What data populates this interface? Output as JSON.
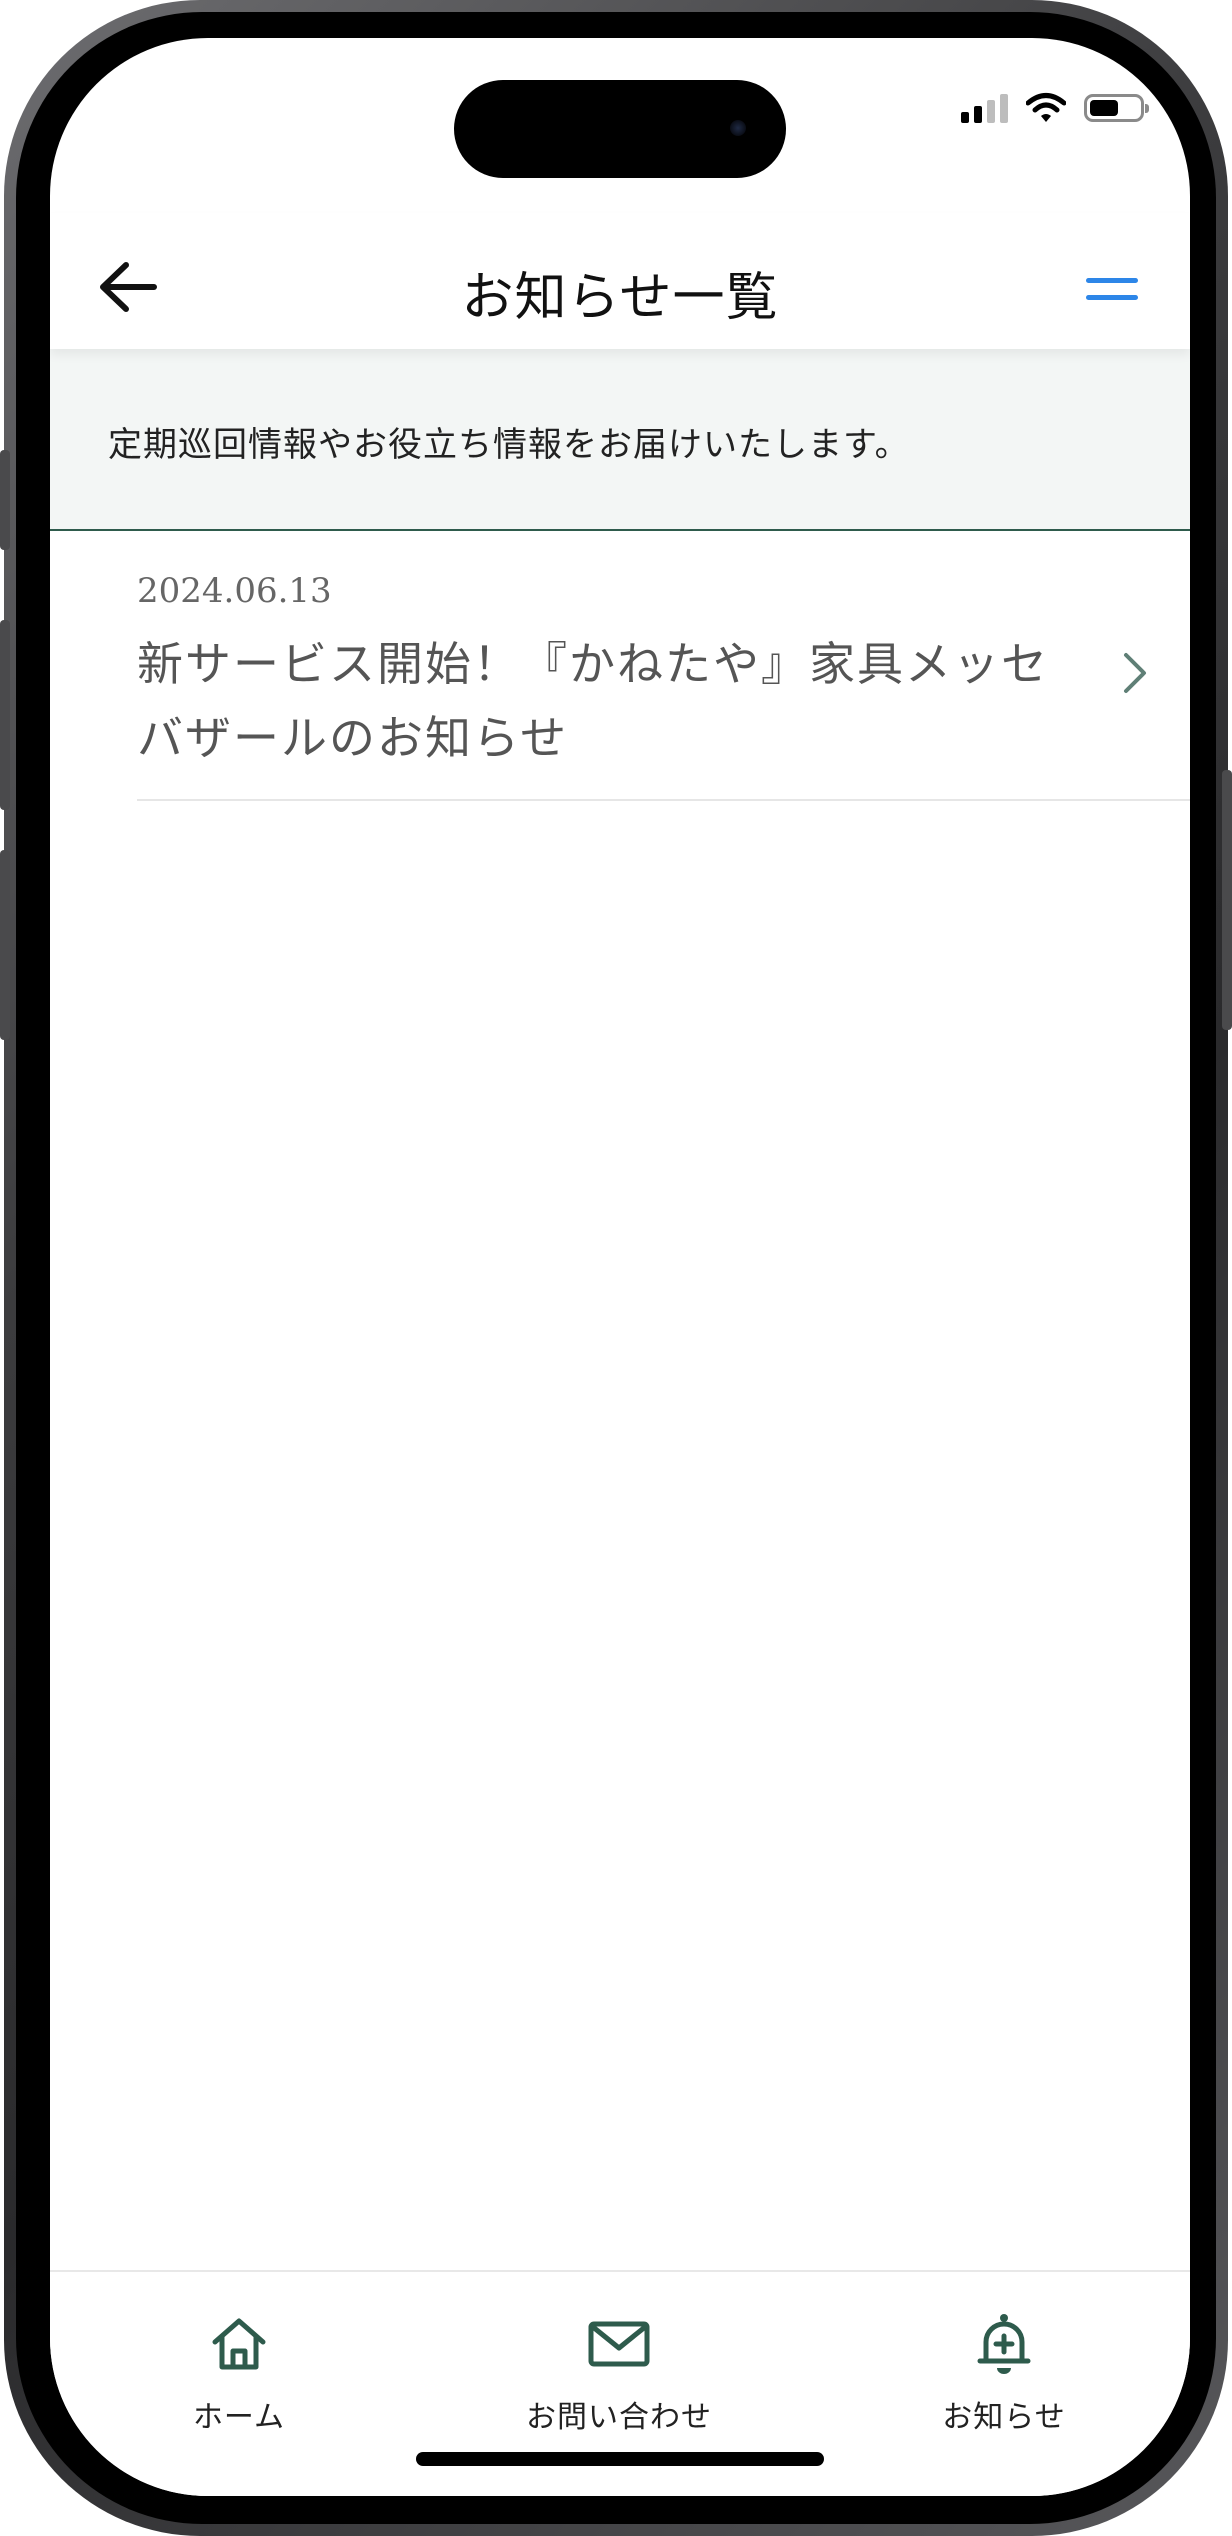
{
  "header": {
    "title": "お知らせ一覧"
  },
  "banner": {
    "text": "定期巡回情報やお役立ち情報をお届けいたします。"
  },
  "news": [
    {
      "date": "2024.06.13",
      "title": "新サービス開始！『かねたや』家具メッセバザールのお知らせ"
    }
  ],
  "tabbar": {
    "home_label": "ホーム",
    "contact_label": "お問い合わせ",
    "news_label": "お知らせ"
  },
  "colors": {
    "accent_green": "#2e5b4c",
    "menu_blue": "#2d86e8",
    "banner_bg": "#f3f6f5"
  },
  "icons": {
    "back": "arrow-left-icon",
    "menu": "menu-icon",
    "chevron": "chevron-right-icon",
    "home": "home-icon",
    "contact": "mail-icon",
    "news": "bell-plus-icon"
  }
}
